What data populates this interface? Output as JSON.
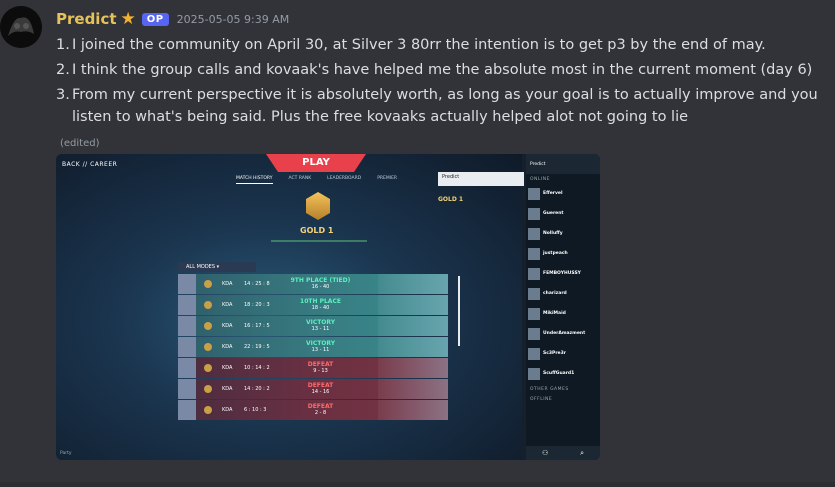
{
  "post": {
    "username": "Predict",
    "badge": "OP",
    "timestamp": "2025-05-05 9:39 AM",
    "edited": "(edited)",
    "lines": [
      {
        "num": "1.",
        "text": "I joined the community on April 30, at Silver 3 80rr the intention is to get p3 by the end of may."
      },
      {
        "num": "2.",
        "text": "I think the group calls and kovaak's have helped me the absolute most in the current moment (day 6)"
      },
      {
        "num": "3.",
        "text": "From my current perspective it is absolutely worth, as long as your goal is to actually improve and you listen to what's being said. Plus the free kovaaks actually helped alot not going to lie"
      }
    ]
  },
  "screenshot": {
    "back_label": "BACK // CAREER",
    "play_label": "PLAY",
    "tabs": [
      "MATCH HISTORY",
      "ACT RANK",
      "LEADERBOARD",
      "PREMIER"
    ],
    "rank": "GOLD 1",
    "notification": {
      "name": "Predict",
      "rank": "GOLD 1"
    },
    "modes_label": "ALL MODES",
    "matches": [
      {
        "kda": "KDA",
        "score": "14 : 25 : 8",
        "result": "9TH PLACE (TIED)",
        "detail": "16 - 40",
        "outcome": "win"
      },
      {
        "kda": "KDA",
        "score": "18 : 20 : 3",
        "result": "10TH PLACE",
        "detail": "18 - 40",
        "outcome": "win"
      },
      {
        "kda": "KDA",
        "score": "16 : 17 : 5",
        "result": "VICTORY",
        "detail": "13 - 11",
        "outcome": "win"
      },
      {
        "kda": "KDA",
        "score": "22 : 19 : 5",
        "result": "VICTORY",
        "detail": "13 - 11",
        "outcome": "win"
      },
      {
        "kda": "KDA",
        "score": "10 : 14 : 2",
        "result": "DEFEAT",
        "detail": "9 - 13",
        "outcome": "loss"
      },
      {
        "kda": "KDA",
        "score": "14 : 20 : 2",
        "result": "DEFEAT",
        "detail": "14 - 16",
        "outcome": "loss"
      },
      {
        "kda": "KDA",
        "score": "6 : 10 : 3",
        "result": "DEFEAT",
        "detail": "2 - 8",
        "outcome": "loss"
      }
    ],
    "friends": {
      "self": "Predict",
      "online_label": "ONLINE",
      "list": [
        "Effervel",
        "Guerent",
        "Nolluffy",
        "justpeach",
        "FEMBOYHUSSY",
        "charizard",
        "MikiMaid",
        "UnderAmazment",
        "Sc3Pre3r",
        "ScuffGuard1"
      ],
      "other_label": "OTHER GAMES",
      "offline_label": "OFFLINE"
    },
    "party_label": "Party"
  },
  "colors": {
    "username": "#e5c35a",
    "badge": "#5865f2",
    "win": "#5ef0c0",
    "loss": "#ff6a6a",
    "play": "#e8414b"
  }
}
